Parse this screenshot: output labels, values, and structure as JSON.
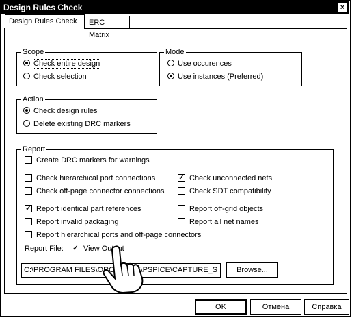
{
  "window": {
    "title": "Design Rules Check",
    "close_label": "×"
  },
  "tabs": [
    {
      "label": "Design Rules Check",
      "active": true
    },
    {
      "label": "ERC Matrix",
      "active": false
    }
  ],
  "scope": {
    "legend": "Scope",
    "options": [
      {
        "label": "Check entire design",
        "selected": true
      },
      {
        "label": "Check selection",
        "selected": false
      }
    ]
  },
  "mode": {
    "legend": "Mode",
    "options": [
      {
        "label": "Use occurences",
        "selected": false
      },
      {
        "label": "Use instances (Preferred)",
        "selected": true
      }
    ]
  },
  "action": {
    "legend": "Action",
    "options": [
      {
        "label": "Check design rules",
        "selected": true
      },
      {
        "label": "Delete existing DRC markers",
        "selected": false
      }
    ]
  },
  "report": {
    "legend": "Report",
    "create_markers": {
      "label": "Create DRC markers for warnings",
      "checked": false
    },
    "left_checks": [
      {
        "label": "Check hierarchical port connections",
        "checked": false
      },
      {
        "label": "Check off-page connector connections",
        "checked": false
      },
      {
        "label": "Report identical part references",
        "checked": true
      },
      {
        "label": "Report invalid packaging",
        "checked": false
      },
      {
        "label": "Report hierarchical ports and off-page connectors",
        "checked": false
      }
    ],
    "right_checks": [
      {
        "label": "Check unconnected nets",
        "checked": true
      },
      {
        "label": "Check SDT compatibility",
        "checked": false
      },
      {
        "label": "Report off-grid objects",
        "checked": false
      },
      {
        "label": "Report all net names",
        "checked": false
      }
    ],
    "report_file_label": "Report File:",
    "view_output": {
      "label": "View Output",
      "checked": true
    },
    "file_path": "C:\\PROGRAM FILES\\ORCADLITE\\PSPICE\\CAPTURE_S",
    "browse_label": "Browse..."
  },
  "buttons": {
    "ok": "OK",
    "cancel": "Отмена",
    "help": "Справка"
  },
  "colors": {
    "titlebar": "#000000",
    "background": "#ffffff"
  },
  "icons": {
    "cursor": "hand-pointer-icon"
  }
}
